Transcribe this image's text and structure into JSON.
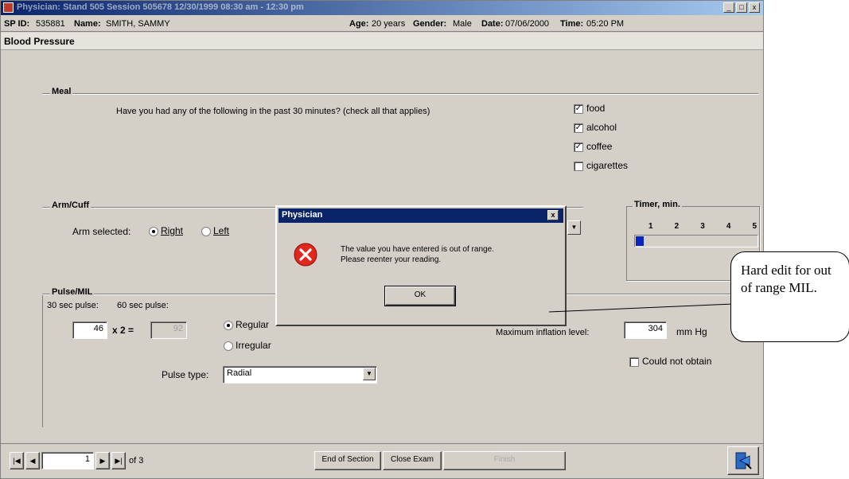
{
  "window": {
    "title": "Physician: Stand 505 Session 505678 12/30/1999 08:30 am - 12:30 pm",
    "controls": [
      "_",
      "□",
      "x"
    ]
  },
  "info": {
    "sp_id_label": "SP ID:",
    "sp_id": "535881",
    "name_label": "Name:",
    "name": "SMITH, SAMMY",
    "age_label": "Age:",
    "age": "20 years",
    "gender_label": "Gender:",
    "gender": "Male",
    "date_label": "Date:",
    "date": "07/06/2000",
    "time_label": "Time:",
    "time": "05:20 PM"
  },
  "section": {
    "title": "Blood Pressure"
  },
  "meal": {
    "group_label": "Meal",
    "question": "Have you had any of the following in the past 30 minutes? (check all that applies)",
    "options": [
      {
        "label": "food",
        "checked": true
      },
      {
        "label": "alcohol",
        "checked": true
      },
      {
        "label": "coffee",
        "checked": true
      },
      {
        "label": "cigarettes",
        "checked": false
      }
    ]
  },
  "armcuff": {
    "group_label": "Arm/Cuff",
    "arm_label": "Arm selected:",
    "right": "Right",
    "left": "Left",
    "selected": "Right"
  },
  "timer": {
    "group_label": "Timer, min.",
    "ticks": [
      "1",
      "2",
      "3",
      "4",
      "5"
    ],
    "progress_fraction": 0.05
  },
  "pulse": {
    "group_label": "Pulse/MIL",
    "sec30_label": "30 sec pulse:",
    "sec60_label": "60 sec pulse:",
    "sec30_value": "46",
    "multiplier": "x 2 =",
    "sec60_value": "92",
    "regular": "Regular",
    "irregular": "Irregular",
    "rhythm_selected": "Regular",
    "type_label": "Pulse type:",
    "type_value": "Radial",
    "mil_label": "Maximum inflation level:",
    "mil_value": "304",
    "mil_unit": "mm Hg",
    "could_not_obtain": "Could not obtain"
  },
  "dialog": {
    "title": "Physician",
    "message_line1": "The value you have entered is out of range.",
    "message_line2": "Please reenter your reading.",
    "ok": "OK",
    "close": "x"
  },
  "nav": {
    "page": "1",
    "of": "of 3",
    "end_section": "End of Section",
    "close_exam": "Close Exam",
    "finish": "Finish"
  },
  "callout": {
    "text": "Hard edit for out of range MIL."
  }
}
